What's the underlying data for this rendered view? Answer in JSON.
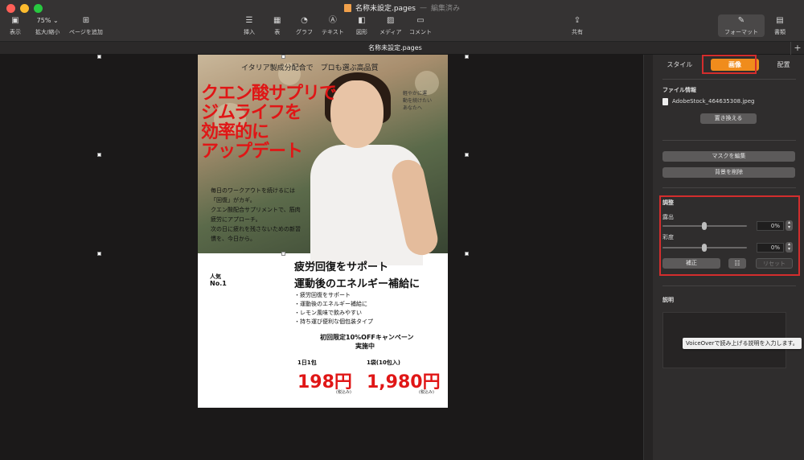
{
  "window": {
    "title": "名称未設定.pages",
    "separator": "—",
    "status": "編集済み",
    "doc_tab": "名称未設定.pages"
  },
  "toolbar": {
    "view": "表示",
    "zoom_value": "75%",
    "zoom_label": "拡大/縮小",
    "add_page": "ページを追加",
    "insert": "挿入",
    "table": "表",
    "chart": "グラフ",
    "text": "テキスト",
    "shape": "図形",
    "media": "メディア",
    "comment": "コメント",
    "share": "共有",
    "format": "フォーマット",
    "document": "書類"
  },
  "page": {
    "top_line": "イタリア製成分配合で　プロも選ぶ高品質",
    "headline": [
      "クエン酸サプリで",
      "ジムライフを",
      "効率的に",
      "アップデート"
    ],
    "side_note": [
      "軽やかに運",
      "動を続けたい",
      "あなたへ"
    ],
    "body": [
      "毎日のワークアウトを続けるには",
      "「回復」がカギ。",
      "クエン酸配合サプリメントで、筋肉",
      "疲労にアプローチ。",
      "次の日に疲れを残さないための新習",
      "慣を、今日から。"
    ],
    "popular": "人気",
    "no1": "No.1",
    "sub_head_1": "疲労回復をサポート",
    "sub_head_2": "運動後のエネルギー補給に",
    "bullets": [
      "・疲労回復をサポート",
      "・運動後のエネルギー補給に",
      "・レモン風味で飲みやすい",
      "・持ち運び便利な個包装タイプ"
    ],
    "campaign_1": "初回限定10%OFFキャンペーン",
    "campaign_2": "実施中",
    "price_a_label": "1日1包",
    "price_a": "198円",
    "price_a_tax": "(税込み)",
    "price_b_label": "1袋(10包入)",
    "price_b": "1,980円",
    "price_b_tax": "(税込み)"
  },
  "panel": {
    "tab_style": "スタイル",
    "tab_image": "画像",
    "tab_arrange": "配置",
    "file_info": "ファイル情報",
    "file_name": "AdobeStock_464635308.jpeg",
    "replace": "置き換える",
    "edit_mask": "マスクを編集",
    "remove_bg": "背景を削除",
    "adjust": "調整",
    "exposure": "露出",
    "exposure_value": "0%",
    "saturation": "彩度",
    "saturation_value": "0%",
    "enhance": "補正",
    "reset": "リセット",
    "description": "説明",
    "tooltip": "VoiceOverで読み上げる説明を入力します。"
  },
  "colors": {
    "accent": "#f08c1c",
    "highlight": "#d32d2d",
    "price_red": "#e01616"
  }
}
